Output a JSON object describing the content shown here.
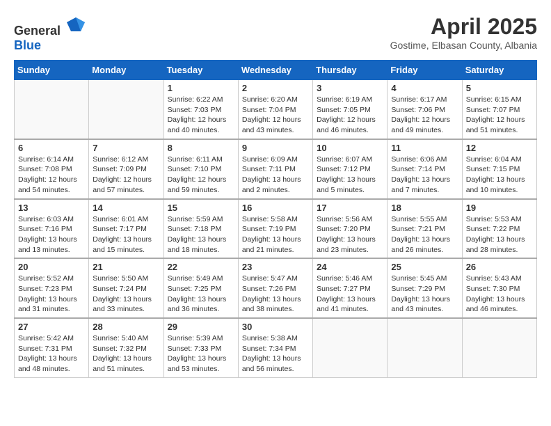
{
  "header": {
    "logo_general": "General",
    "logo_blue": "Blue",
    "month_year": "April 2025",
    "location": "Gostime, Elbasan County, Albania"
  },
  "days_of_week": [
    "Sunday",
    "Monday",
    "Tuesday",
    "Wednesday",
    "Thursday",
    "Friday",
    "Saturday"
  ],
  "weeks": [
    [
      {
        "day": "",
        "info": ""
      },
      {
        "day": "",
        "info": ""
      },
      {
        "day": "1",
        "info": "Sunrise: 6:22 AM\nSunset: 7:03 PM\nDaylight: 12 hours and 40 minutes."
      },
      {
        "day": "2",
        "info": "Sunrise: 6:20 AM\nSunset: 7:04 PM\nDaylight: 12 hours and 43 minutes."
      },
      {
        "day": "3",
        "info": "Sunrise: 6:19 AM\nSunset: 7:05 PM\nDaylight: 12 hours and 46 minutes."
      },
      {
        "day": "4",
        "info": "Sunrise: 6:17 AM\nSunset: 7:06 PM\nDaylight: 12 hours and 49 minutes."
      },
      {
        "day": "5",
        "info": "Sunrise: 6:15 AM\nSunset: 7:07 PM\nDaylight: 12 hours and 51 minutes."
      }
    ],
    [
      {
        "day": "6",
        "info": "Sunrise: 6:14 AM\nSunset: 7:08 PM\nDaylight: 12 hours and 54 minutes."
      },
      {
        "day": "7",
        "info": "Sunrise: 6:12 AM\nSunset: 7:09 PM\nDaylight: 12 hours and 57 minutes."
      },
      {
        "day": "8",
        "info": "Sunrise: 6:11 AM\nSunset: 7:10 PM\nDaylight: 12 hours and 59 minutes."
      },
      {
        "day": "9",
        "info": "Sunrise: 6:09 AM\nSunset: 7:11 PM\nDaylight: 13 hours and 2 minutes."
      },
      {
        "day": "10",
        "info": "Sunrise: 6:07 AM\nSunset: 7:12 PM\nDaylight: 13 hours and 5 minutes."
      },
      {
        "day": "11",
        "info": "Sunrise: 6:06 AM\nSunset: 7:14 PM\nDaylight: 13 hours and 7 minutes."
      },
      {
        "day": "12",
        "info": "Sunrise: 6:04 AM\nSunset: 7:15 PM\nDaylight: 13 hours and 10 minutes."
      }
    ],
    [
      {
        "day": "13",
        "info": "Sunrise: 6:03 AM\nSunset: 7:16 PM\nDaylight: 13 hours and 13 minutes."
      },
      {
        "day": "14",
        "info": "Sunrise: 6:01 AM\nSunset: 7:17 PM\nDaylight: 13 hours and 15 minutes."
      },
      {
        "day": "15",
        "info": "Sunrise: 5:59 AM\nSunset: 7:18 PM\nDaylight: 13 hours and 18 minutes."
      },
      {
        "day": "16",
        "info": "Sunrise: 5:58 AM\nSunset: 7:19 PM\nDaylight: 13 hours and 21 minutes."
      },
      {
        "day": "17",
        "info": "Sunrise: 5:56 AM\nSunset: 7:20 PM\nDaylight: 13 hours and 23 minutes."
      },
      {
        "day": "18",
        "info": "Sunrise: 5:55 AM\nSunset: 7:21 PM\nDaylight: 13 hours and 26 minutes."
      },
      {
        "day": "19",
        "info": "Sunrise: 5:53 AM\nSunset: 7:22 PM\nDaylight: 13 hours and 28 minutes."
      }
    ],
    [
      {
        "day": "20",
        "info": "Sunrise: 5:52 AM\nSunset: 7:23 PM\nDaylight: 13 hours and 31 minutes."
      },
      {
        "day": "21",
        "info": "Sunrise: 5:50 AM\nSunset: 7:24 PM\nDaylight: 13 hours and 33 minutes."
      },
      {
        "day": "22",
        "info": "Sunrise: 5:49 AM\nSunset: 7:25 PM\nDaylight: 13 hours and 36 minutes."
      },
      {
        "day": "23",
        "info": "Sunrise: 5:47 AM\nSunset: 7:26 PM\nDaylight: 13 hours and 38 minutes."
      },
      {
        "day": "24",
        "info": "Sunrise: 5:46 AM\nSunset: 7:27 PM\nDaylight: 13 hours and 41 minutes."
      },
      {
        "day": "25",
        "info": "Sunrise: 5:45 AM\nSunset: 7:29 PM\nDaylight: 13 hours and 43 minutes."
      },
      {
        "day": "26",
        "info": "Sunrise: 5:43 AM\nSunset: 7:30 PM\nDaylight: 13 hours and 46 minutes."
      }
    ],
    [
      {
        "day": "27",
        "info": "Sunrise: 5:42 AM\nSunset: 7:31 PM\nDaylight: 13 hours and 48 minutes."
      },
      {
        "day": "28",
        "info": "Sunrise: 5:40 AM\nSunset: 7:32 PM\nDaylight: 13 hours and 51 minutes."
      },
      {
        "day": "29",
        "info": "Sunrise: 5:39 AM\nSunset: 7:33 PM\nDaylight: 13 hours and 53 minutes."
      },
      {
        "day": "30",
        "info": "Sunrise: 5:38 AM\nSunset: 7:34 PM\nDaylight: 13 hours and 56 minutes."
      },
      {
        "day": "",
        "info": ""
      },
      {
        "day": "",
        "info": ""
      },
      {
        "day": "",
        "info": ""
      }
    ]
  ]
}
